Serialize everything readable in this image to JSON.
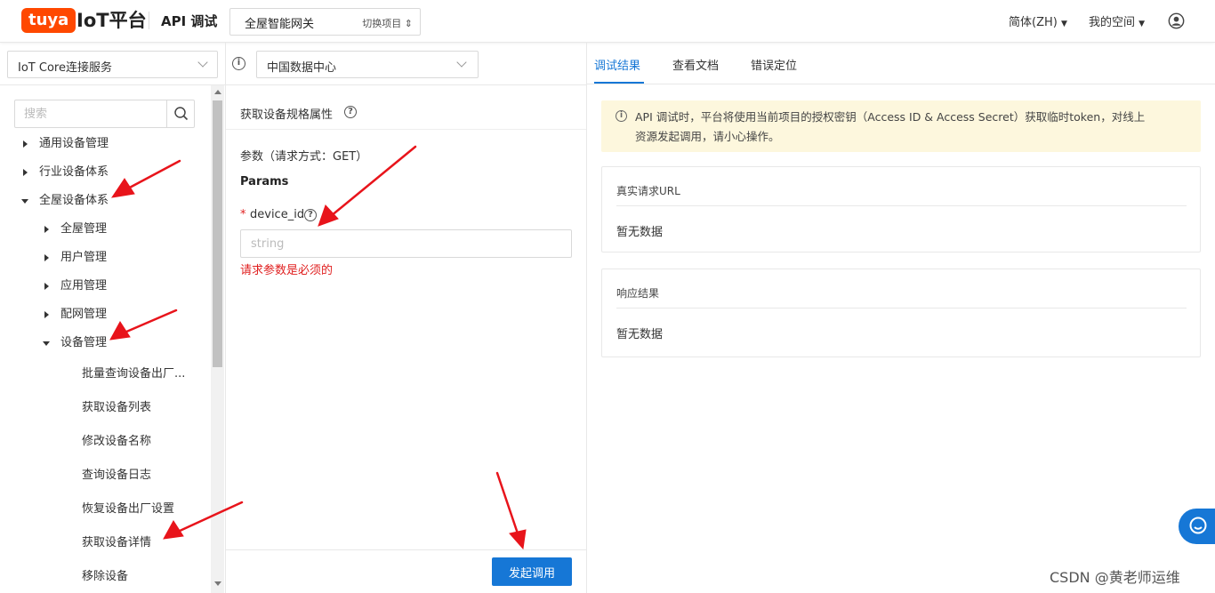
{
  "header": {
    "logo": "tuya",
    "platform": "IoT平台",
    "title": "API 调试",
    "project_name": "全屋智能网关",
    "project_switch": "切换项目",
    "language": "简体(ZH)",
    "space": "我的空间"
  },
  "left": {
    "service": "IoT Core连接服务",
    "search_placeholder": "搜索",
    "tree": [
      {
        "label": "通用设备管理"
      },
      {
        "label": "行业设备体系"
      },
      {
        "label": "全屋设备体系"
      },
      {
        "label": "全屋管理"
      },
      {
        "label": "用户管理"
      },
      {
        "label": "应用管理"
      },
      {
        "label": "配网管理"
      },
      {
        "label": "设备管理"
      },
      {
        "label": "批量查询设备出厂..."
      },
      {
        "label": "获取设备列表"
      },
      {
        "label": "修改设备名称"
      },
      {
        "label": "查询设备日志"
      },
      {
        "label": "恢复设备出厂设置"
      },
      {
        "label": "获取设备详情"
      },
      {
        "label": "移除设备"
      }
    ]
  },
  "middle": {
    "data_center": "中国数据中心",
    "api_name": "获取设备规格属性",
    "param_title": "参数（请求方式：GET）",
    "params_label": "Params",
    "required_mark": "*",
    "field_label": "device_id",
    "field_colon": ":",
    "field_placeholder": "string",
    "field_value": "",
    "error_text": "请求参数是必须的",
    "submit_label": "发起调用"
  },
  "right": {
    "tabs": [
      {
        "label": "调试结果",
        "active": true
      },
      {
        "label": "查看文档",
        "active": false
      },
      {
        "label": "错误定位",
        "active": false
      }
    ],
    "notice_line1": "API 调试时，平台将使用当前项目的授权密钥（Access ID & Access Secret）获取临时token，对线上",
    "notice_line2": "资源发起调用，请小心操作。",
    "url_card": {
      "title": "真实请求URL",
      "body": "暂无数据"
    },
    "response_card": {
      "title": "响应结果",
      "body": "暂无数据"
    }
  },
  "watermark": "CSDN @黄老师运维",
  "colors": {
    "brand": "#ff4800",
    "accent": "#1677d6",
    "error": "#e02020",
    "notice_bg": "#fdf7dd",
    "annotation_arrow": "#e8141b"
  }
}
